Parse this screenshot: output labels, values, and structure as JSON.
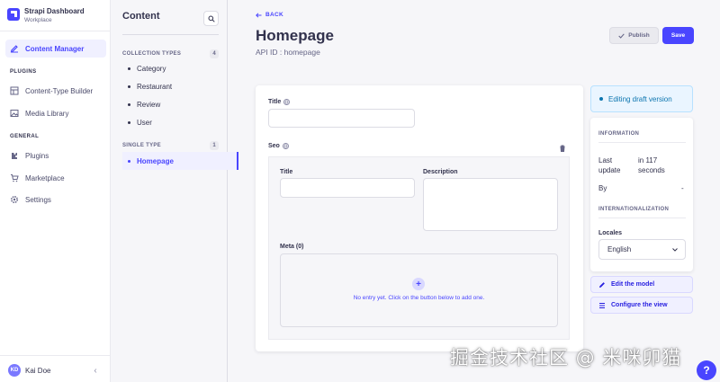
{
  "brand": {
    "title": "Strapi Dashboard",
    "subtitle": "Workplace"
  },
  "nav": {
    "content_manager": "Content Manager",
    "plugins_section": "PLUGINS",
    "content_type_builder": "Content-Type Builder",
    "media_library": "Media Library",
    "general_section": "GENERAL",
    "plugins": "Plugins",
    "marketplace": "Marketplace",
    "settings": "Settings"
  },
  "user": {
    "initials": "KD",
    "name": "Kai Doe"
  },
  "subnav": {
    "title": "Content",
    "collection_types": {
      "label": "COLLECTION TYPES",
      "count": "4",
      "items": [
        "Category",
        "Restaurant",
        "Review",
        "User"
      ]
    },
    "single_types": {
      "label": "SINGLE TYPE",
      "count": "1",
      "items": [
        "Homepage"
      ]
    }
  },
  "header": {
    "back": "BACK",
    "title": "Homepage",
    "api_id": "API ID : homepage",
    "publish": "Publish",
    "save": "Save"
  },
  "form": {
    "title_label": "Title",
    "seo_label": "Seo",
    "seo_title_label": "Title",
    "seo_description_label": "Description",
    "meta_label": "Meta (0)",
    "empty_text": "No entry yet. Click on the button below to add one."
  },
  "side": {
    "draft": "Editing draft version",
    "information": "INFORMATION",
    "last_update_key": "Last update",
    "last_update_value": "in 117 seconds",
    "by_key": "By",
    "by_value": "-",
    "internationalization": "INTERNATIONALIZATION",
    "locales_label": "Locales",
    "locale_value": "English",
    "edit_model": "Edit the model",
    "configure_view": "Configure the view"
  },
  "watermark": "掘金技术社区 @ 米咪卯猫",
  "help": "?",
  "colors": {
    "primary": "#4945ff",
    "draft_text": "#0c75af"
  }
}
